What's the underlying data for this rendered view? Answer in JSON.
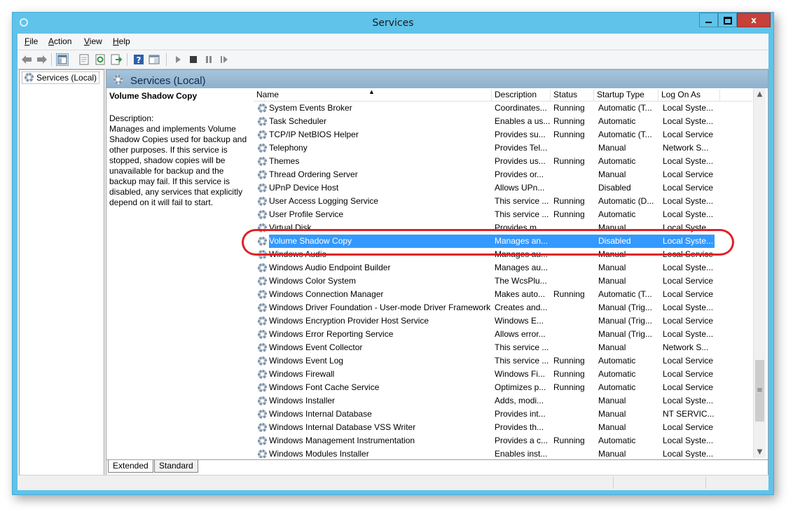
{
  "window": {
    "title": "Services",
    "close_glyph": "x"
  },
  "menu": {
    "items": [
      "File",
      "Action",
      "View",
      "Help"
    ]
  },
  "toolbar": {
    "icons": [
      "back-icon",
      "forward-icon",
      "console-tree-icon",
      "properties-icon",
      "refresh-icon",
      "export-icon",
      "help-icon",
      "show-hide-icon",
      "start-icon",
      "stop-icon",
      "pause-icon",
      "restart-icon"
    ]
  },
  "tree": {
    "root_label": "Services (Local)"
  },
  "pane": {
    "title": "Services (Local)",
    "selected_name": "Volume Shadow Copy",
    "description_label": "Description:",
    "description_text": "Manages and implements Volume Shadow Copies used for backup and other purposes. If this service is stopped, shadow copies will be unavailable for backup and the backup may fail. If this service is disabled, any services that explicitly depend on it will fail to start."
  },
  "columns": {
    "name": "Name",
    "description": "Description",
    "status": "Status",
    "startup": "Startup Type",
    "logon": "Log On As"
  },
  "rows": [
    {
      "name": "System Events Broker",
      "description": "Coordinates...",
      "status": "Running",
      "startup": "Automatic (T...",
      "logon": "Local Syste..."
    },
    {
      "name": "Task Scheduler",
      "description": "Enables a us...",
      "status": "Running",
      "startup": "Automatic",
      "logon": "Local Syste..."
    },
    {
      "name": "TCP/IP NetBIOS Helper",
      "description": "Provides su...",
      "status": "Running",
      "startup": "Automatic (T...",
      "logon": "Local Service"
    },
    {
      "name": "Telephony",
      "description": "Provides Tel...",
      "status": "",
      "startup": "Manual",
      "logon": "Network S..."
    },
    {
      "name": "Themes",
      "description": "Provides us...",
      "status": "Running",
      "startup": "Automatic",
      "logon": "Local Syste..."
    },
    {
      "name": "Thread Ordering Server",
      "description": "Provides or...",
      "status": "",
      "startup": "Manual",
      "logon": "Local Service"
    },
    {
      "name": "UPnP Device Host",
      "description": "Allows UPn...",
      "status": "",
      "startup": "Disabled",
      "logon": "Local Service"
    },
    {
      "name": "User Access Logging Service",
      "description": "This service ...",
      "status": "Running",
      "startup": "Automatic (D...",
      "logon": "Local Syste..."
    },
    {
      "name": "User Profile Service",
      "description": "This service ...",
      "status": "Running",
      "startup": "Automatic",
      "logon": "Local Syste..."
    },
    {
      "name": "Virtual Disk",
      "description": "Provides m...",
      "status": "",
      "startup": "Manual",
      "logon": "Local Syste..."
    },
    {
      "name": "Volume Shadow Copy",
      "description": "Manages an...",
      "status": "",
      "startup": "Disabled",
      "logon": "Local Syste...",
      "selected": true
    },
    {
      "name": "Windows Audio",
      "description": "Manages au...",
      "status": "",
      "startup": "Manual",
      "logon": "Local Service"
    },
    {
      "name": "Windows Audio Endpoint Builder",
      "description": "Manages au...",
      "status": "",
      "startup": "Manual",
      "logon": "Local Syste..."
    },
    {
      "name": "Windows Color System",
      "description": "The WcsPlu...",
      "status": "",
      "startup": "Manual",
      "logon": "Local Service"
    },
    {
      "name": "Windows Connection Manager",
      "description": "Makes auto...",
      "status": "Running",
      "startup": "Automatic (T...",
      "logon": "Local Service"
    },
    {
      "name": "Windows Driver Foundation - User-mode Driver Framework",
      "description": "Creates and...",
      "status": "",
      "startup": "Manual (Trig...",
      "logon": "Local Syste..."
    },
    {
      "name": "Windows Encryption Provider Host Service",
      "description": "Windows E...",
      "status": "",
      "startup": "Manual (Trig...",
      "logon": "Local Service"
    },
    {
      "name": "Windows Error Reporting Service",
      "description": "Allows error...",
      "status": "",
      "startup": "Manual (Trig...",
      "logon": "Local Syste..."
    },
    {
      "name": "Windows Event Collector",
      "description": "This service ...",
      "status": "",
      "startup": "Manual",
      "logon": "Network S..."
    },
    {
      "name": "Windows Event Log",
      "description": "This service ...",
      "status": "Running",
      "startup": "Automatic",
      "logon": "Local Service"
    },
    {
      "name": "Windows Firewall",
      "description": "Windows Fi...",
      "status": "Running",
      "startup": "Automatic",
      "logon": "Local Service"
    },
    {
      "name": "Windows Font Cache Service",
      "description": "Optimizes p...",
      "status": "Running",
      "startup": "Automatic",
      "logon": "Local Service"
    },
    {
      "name": "Windows Installer",
      "description": "Adds, modi...",
      "status": "",
      "startup": "Manual",
      "logon": "Local Syste..."
    },
    {
      "name": "Windows Internal Database",
      "description": "Provides int...",
      "status": "",
      "startup": "Manual",
      "logon": "NT SERVIC..."
    },
    {
      "name": "Windows Internal Database VSS Writer",
      "description": "Provides th...",
      "status": "",
      "startup": "Manual",
      "logon": "Local Service"
    },
    {
      "name": "Windows Management Instrumentation",
      "description": "Provides a c...",
      "status": "Running",
      "startup": "Automatic",
      "logon": "Local Syste..."
    },
    {
      "name": "Windows Modules Installer",
      "description": "Enables inst...",
      "status": "",
      "startup": "Manual",
      "logon": "Local Syste..."
    }
  ],
  "tabs": [
    "Extended",
    "Standard"
  ],
  "colors": {
    "titlebar": "#5fc3ea",
    "selection": "#3399ff",
    "annotation": "#e02027",
    "close": "#c7403a"
  }
}
